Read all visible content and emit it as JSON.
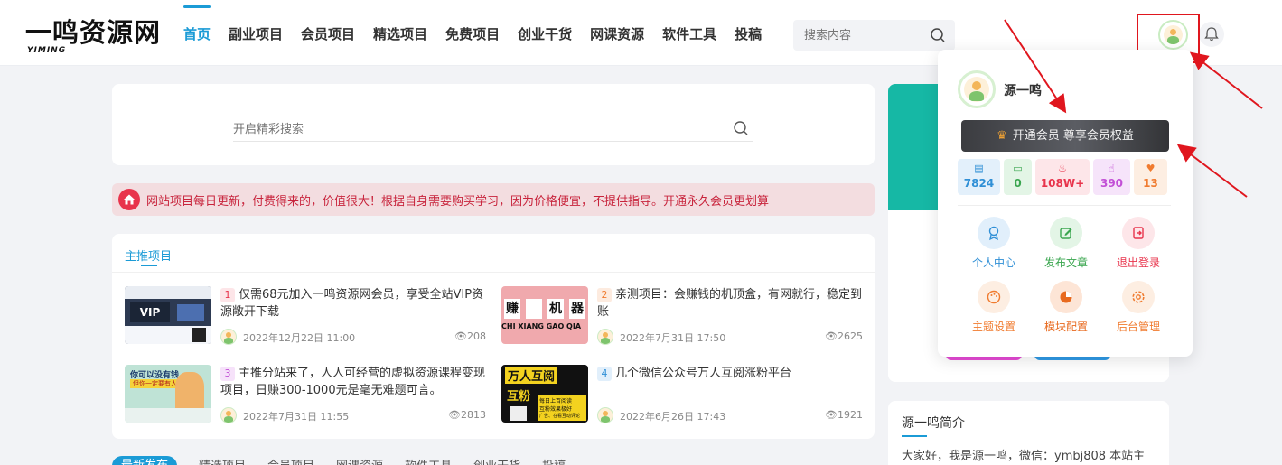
{
  "header": {
    "logo_text": "一鸣资源网",
    "logo_sub": "YIMING",
    "nav": [
      {
        "label": "首页",
        "active": true
      },
      {
        "label": "副业项目",
        "active": false
      },
      {
        "label": "会员项目",
        "active": false
      },
      {
        "label": "精选项目",
        "active": false
      },
      {
        "label": "免费项目",
        "active": false
      },
      {
        "label": "创业干货",
        "active": false
      },
      {
        "label": "网课资源",
        "active": false
      },
      {
        "label": "软件工具",
        "active": false
      },
      {
        "label": "投稿",
        "active": false
      }
    ],
    "search_placeholder": "搜索内容"
  },
  "hero": {
    "search_placeholder": "开启精彩搜索"
  },
  "notice": {
    "text": "网站项目每日更新，付费得来的，价值很大！根据自身需要购买学习，因为价格便宜，不提供指导。开通永久会员更划算"
  },
  "featured": {
    "title": "主推项目",
    "posts": [
      {
        "num": "1",
        "title": "仅需68元加入一鸣资源网会员，享受全站VIP资源敞开下载",
        "date": "2022年12月22日 11:00",
        "views": "208",
        "num_color": "#e8344c",
        "num_bg": "#fde5e8"
      },
      {
        "num": "2",
        "title": "亲测项目：会赚钱的机顶盒，有网就行，稳定到账",
        "date": "2022年7月31日 17:50",
        "views": "2625",
        "num_color": "#f07b2f",
        "num_bg": "#fdebdf"
      },
      {
        "num": "3",
        "title": "主推分站来了，人人可经营的虚拟资源课程变现项目，日赚300-1000元是毫无难题可言。",
        "date": "2022年7月31日 11:55",
        "views": "2813",
        "num_color": "#c24fd6",
        "num_bg": "#f6e2fa"
      },
      {
        "num": "4",
        "title": "几个微信公众号万人互阅涨粉平台",
        "date": "2022年6月26日 17:43",
        "views": "1921",
        "num_color": "#2f8fd6",
        "num_bg": "#e1effb"
      }
    ],
    "thumb_texts": {
      "t1": "VIP",
      "t2_chars": [
        "赚",
        "",
        "机",
        "器"
      ],
      "t2_pinyin": "CHI  XIANG  GAO  QIA",
      "t3_line1": "你可以没有钱",
      "t3_line2": "但你一定要有人脉",
      "t4_line1": "万人互阅",
      "t4_line2": "互粉",
      "t4_small": "每日上百阅读",
      "t4_small2": "互粉效果极好",
      "t4_small3": "广告、在看互动评论"
    }
  },
  "tabs": [
    "最新发布",
    "精选项目",
    "会员项目",
    "网课资源",
    "软件工具",
    "创业干货",
    "投稿"
  ],
  "sidebar": {
    "intro_title": "源一鸣简介",
    "intro_text": "大家好，我是源一鸣，微信：ymbj808 本站主"
  },
  "user_menu": {
    "username": "源一鸣",
    "vip_label": "开通会员 尊享会员权益",
    "stats": [
      {
        "icon": "doc-icon",
        "glyph": "▤",
        "value": "7824",
        "color": "#2f8fd6",
        "bg": "#e3f0fb"
      },
      {
        "icon": "comment-icon",
        "glyph": "▭",
        "value": "0",
        "color": "#3aa64f",
        "bg": "#e3f5e6"
      },
      {
        "icon": "fire-icon",
        "glyph": "♨",
        "value": "108W+",
        "color": "#e8344c",
        "bg": "#fde6e9"
      },
      {
        "icon": "thumb-icon",
        "glyph": "☝",
        "value": "390",
        "color": "#c24fd6",
        "bg": "#f6e4fa"
      },
      {
        "icon": "heart-icon",
        "glyph": "♥",
        "value": "13",
        "color": "#f07b2f",
        "bg": "#fdeee2"
      }
    ],
    "grid": [
      {
        "label": "个人中心",
        "icon": "user-center-icon",
        "color": "#2f8fd6",
        "bg": "#e1effb"
      },
      {
        "label": "发布文章",
        "icon": "edit-icon",
        "color": "#3aa64f",
        "bg": "#e3f5e6"
      },
      {
        "label": "退出登录",
        "icon": "logout-icon",
        "color": "#e8344c",
        "bg": "#fde6e9"
      },
      {
        "label": "主题设置",
        "icon": "palette-icon",
        "color": "#f07b2f",
        "bg": "#fdeee2"
      },
      {
        "label": "模块配置",
        "icon": "chart-icon",
        "color": "#e86a1f",
        "bg": "#fde5d6"
      },
      {
        "label": "后台管理",
        "icon": "settings-icon",
        "color": "#f07b2f",
        "bg": "#fdeee2"
      }
    ]
  }
}
